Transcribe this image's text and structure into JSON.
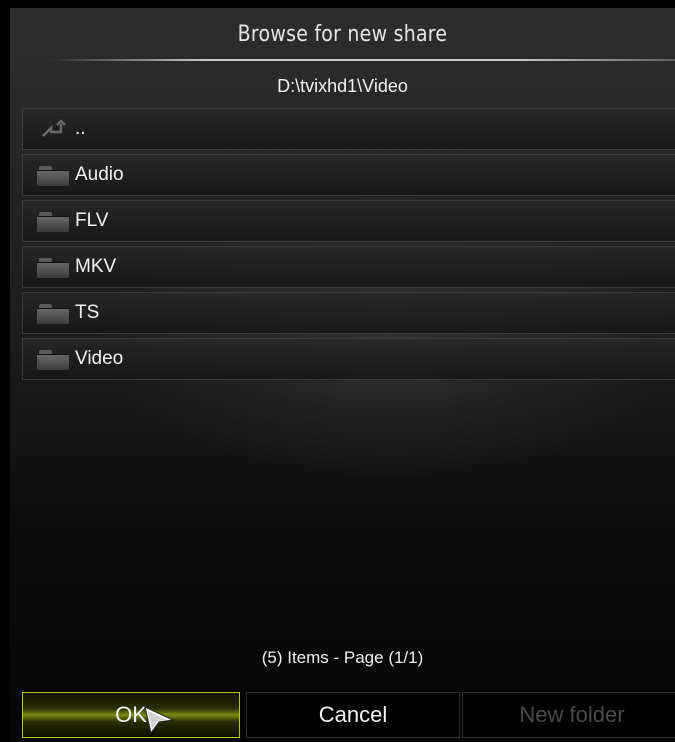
{
  "dialog": {
    "title": "Browse for new share",
    "current_path": "D:\\tvixhd1\\Video"
  },
  "entries": [
    {
      "label": "..",
      "icon": "parent-folder-icon"
    },
    {
      "label": "Audio",
      "icon": "folder-icon"
    },
    {
      "label": "FLV",
      "icon": "folder-icon"
    },
    {
      "label": "MKV",
      "icon": "folder-icon"
    },
    {
      "label": "TS",
      "icon": "folder-icon"
    },
    {
      "label": "Video",
      "icon": "folder-icon"
    }
  ],
  "footer": {
    "items_text": "(5) Items - Page (1/1)"
  },
  "buttons": {
    "ok": "OK",
    "cancel": "Cancel",
    "new_folder": "New folder"
  },
  "colors": {
    "focus_border": "#b6c81e",
    "disabled_text": "#4a4a4a"
  }
}
